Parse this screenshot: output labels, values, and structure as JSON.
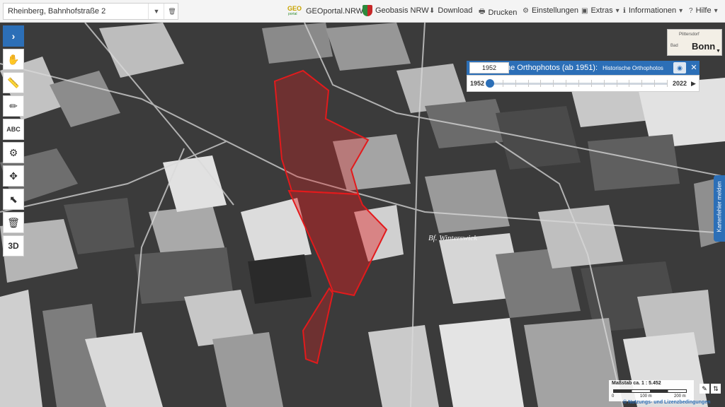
{
  "search": {
    "value": "Rheinberg, Bahnhofstraße 2"
  },
  "header": {
    "brand_geoportal": "GEOportal.NRW",
    "brand_geobasis": "Geobasis NRW",
    "geo_logo_top": "GEO",
    "geo_logo_bottom": "portal",
    "menu": [
      {
        "label": "Download",
        "icon": "download-icon"
      },
      {
        "label": "Drucken",
        "icon": "print-icon"
      },
      {
        "label": "Einstellungen",
        "icon": "gear-icon"
      },
      {
        "label": "Extras",
        "icon": "briefcase-icon",
        "dropdown": true
      },
      {
        "label": "Informationen",
        "icon": "info-icon",
        "dropdown": true
      },
      {
        "label": "Hilfe",
        "icon": "question-icon",
        "dropdown": true
      }
    ]
  },
  "toolbar": {
    "expand_glyph": "›",
    "items": [
      {
        "name": "hand-tool",
        "glyph": "✋"
      },
      {
        "name": "measure-tool",
        "glyph": "📏"
      },
      {
        "name": "draw-tool",
        "glyph": "✏"
      },
      {
        "name": "text-tool",
        "glyph": "ABC"
      },
      {
        "name": "settings-tool",
        "glyph": "⚙"
      },
      {
        "name": "move-tool",
        "glyph": "✥"
      },
      {
        "name": "select-tool",
        "glyph": "⬉"
      },
      {
        "name": "delete-tool",
        "glyph": "🗑"
      },
      {
        "name": "3d-tool",
        "glyph": "3D"
      }
    ]
  },
  "minimap": {
    "label_top": "Plittersdorf",
    "label_left": "Bad",
    "city": "Bonn"
  },
  "timeline": {
    "title_visible": "ne Orthophotos (ab 1951):",
    "subtitle": "Historische Orthophotos",
    "year_min": "1952",
    "year_max": "2022",
    "selected_year": "1952",
    "selected_fraction": 0.0
  },
  "side_tab": {
    "label": "Kartenfehler melden"
  },
  "map": {
    "place_label": "Bf. Winterswick",
    "highlight_color": "#e31a1c"
  },
  "scale": {
    "title": "Maßstab ca. 1 : 5.452",
    "tick0": "0",
    "tick1": "100 m",
    "tick2": "200 m"
  },
  "footer": {
    "license": "© Nutzungs- und Lizenzbedingungen"
  },
  "colors": {
    "accent": "#2c6fb7",
    "highlight": "#e31a1c"
  }
}
